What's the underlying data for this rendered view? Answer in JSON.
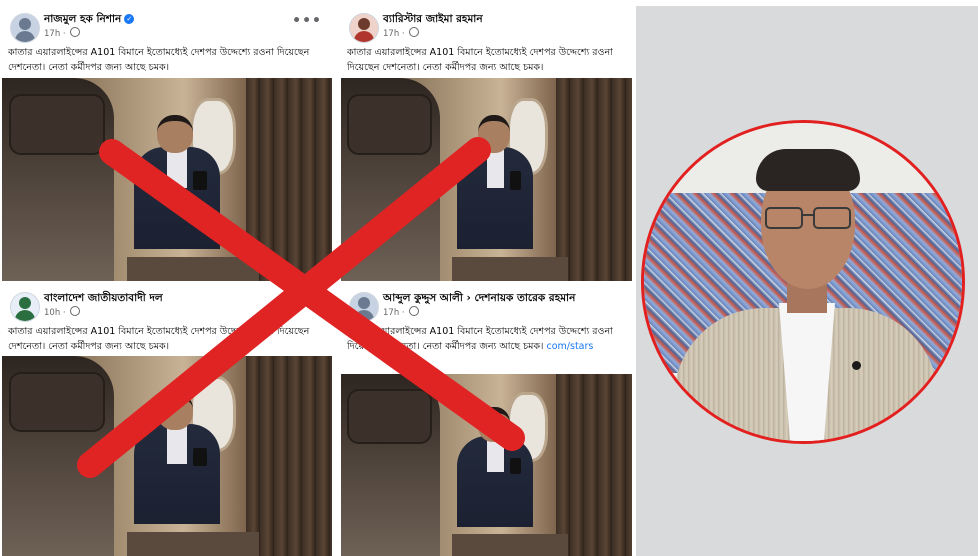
{
  "posts": [
    {
      "author": "নাজমুল হক নিশান",
      "verified": true,
      "time": "17h",
      "caption": "কাতার এয়ারলাইন্সের A101 বিমানে ইতোমধ্যেই দেশপর উদ্দেশ্যে রওনা দিয়েছেন দেশনেতা। নেতা কর্মীদপর জন্য আছে চমক।",
      "link": ""
    },
    {
      "author": "ব্যারিস্টার জাইমা রহমান",
      "verified": false,
      "time": "17h",
      "caption": "কাতার এয়ারলাইন্সের A101 বিমানে ইতোমধ্যেই দেশপর উদ্দেশ্যে রওনা দিয়েছেন দেশনেতা। নেতা কর্মীদপর জন্য আছে চমক।",
      "link": ""
    },
    {
      "author": "বাংলাদেশ জাতীয়তাবাদী দল",
      "verified": false,
      "time": "10h",
      "caption": "কাতার এয়ারলাইন্সের A101 বিমানে ইতোমধ্যেই দেশপর উদ্দেশ্যে রওনা দিয়েছেন দেশনেতা। নেতা কর্মীদপর জন্য আছে চমক।",
      "link": ""
    },
    {
      "author": "আব্দুল কুদ্দুস আলী › দেশনায়ক তারেক রহমান",
      "verified": false,
      "time": "17h",
      "caption": "কাতার এয়ারলাইন্সের A101 বিমানে ইতোমধ্যেই দেশপর উদ্দেশ্যে রওনা দিয়েছেন দেশনেতা। নেতা কর্মীদপর জন্য আছে চমক।",
      "link": "com/stars"
    }
  ],
  "colors": {
    "cross": "#e02424",
    "portrait_ring": "#e2201f",
    "link": "#1877f2"
  },
  "icons": {
    "more": "more-options-icon",
    "privacy": "globe-icon",
    "verified": "verified-badge-icon"
  }
}
